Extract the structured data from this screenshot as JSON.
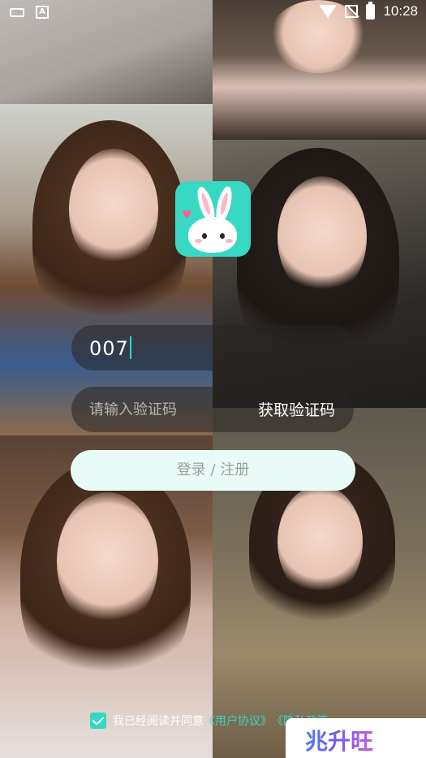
{
  "status_bar": {
    "time": "10:28",
    "left_icons": [
      "keyboard-icon",
      "a-icon"
    ],
    "right_icons": [
      "wifi-icon",
      "no-signal-icon",
      "battery-charging-icon"
    ]
  },
  "app": {
    "logo_icon": "bunny-logo-icon",
    "accent_color": "#35d8c2"
  },
  "login_form": {
    "phone_value": "007",
    "code_placeholder": "请输入验证码",
    "get_code_label": "获取验证码",
    "login_button_label": "登录 / 注册"
  },
  "agreement": {
    "checked": true,
    "prefix": "我已经阅读并同意",
    "user_agreement": "《用户协议》",
    "separator": "《",
    "privacy_policy": "隐私政策"
  },
  "watermark": {
    "text": "兆升旺"
  }
}
